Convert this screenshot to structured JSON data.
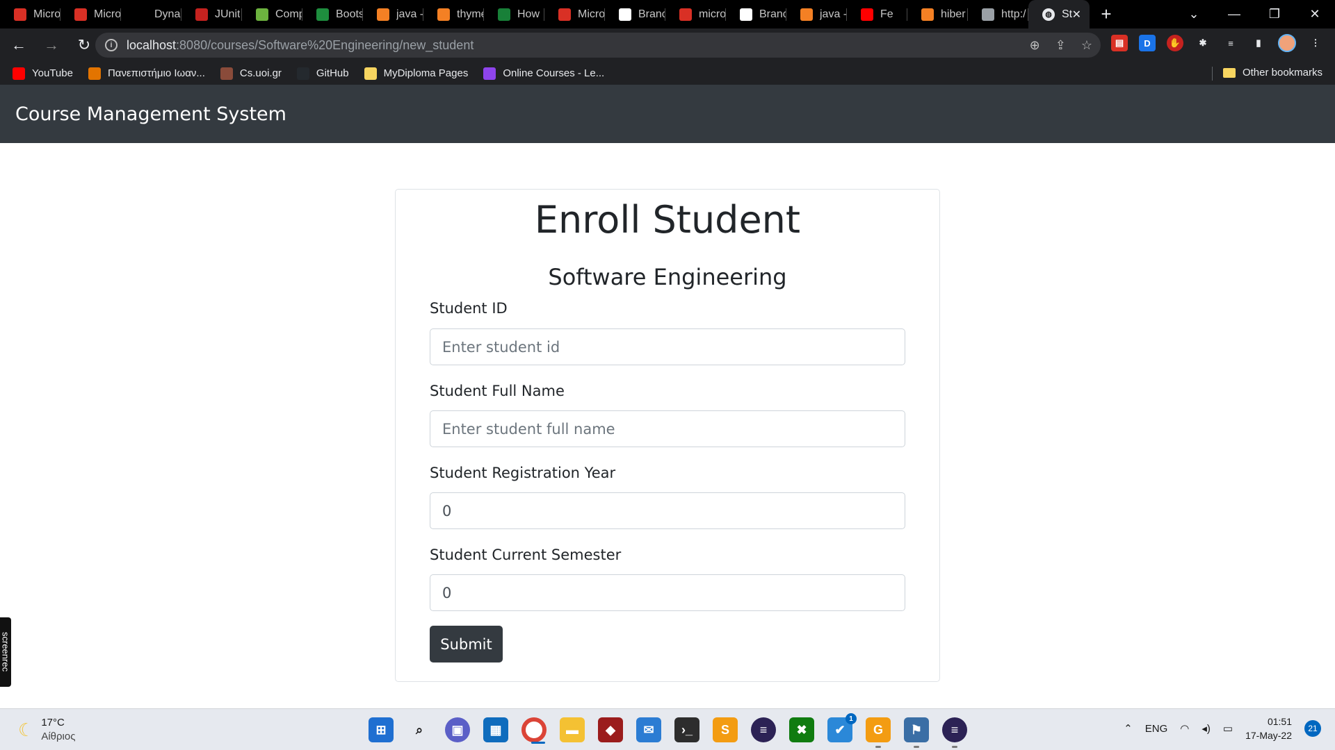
{
  "browser": {
    "tabs": [
      {
        "title": "Micro",
        "icon": "pdf-icon",
        "color": "#d93025"
      },
      {
        "title": "Micro",
        "icon": "pdf-icon",
        "color": "#d93025"
      },
      {
        "title": "Dynam",
        "icon": "pb-icon",
        "color": "#000000"
      },
      {
        "title": "JUnit",
        "icon": "junit-icon",
        "color": "#c5221f"
      },
      {
        "title": "Comp",
        "icon": "leaf-icon",
        "color": "#6db33f"
      },
      {
        "title": "Boots",
        "icon": "w-icon",
        "color": "#1e8e3e"
      },
      {
        "title": "java -",
        "icon": "stackoverflow-icon",
        "color": "#f48024"
      },
      {
        "title": "thyme",
        "icon": "stackoverflow-icon",
        "color": "#f48024"
      },
      {
        "title": "How",
        "icon": "ti-icon",
        "color": "#188038"
      },
      {
        "title": "Micro",
        "icon": "pdf-icon",
        "color": "#d93025"
      },
      {
        "title": "Branc",
        "icon": "wikipedia-icon",
        "color": "#ffffff"
      },
      {
        "title": "micro",
        "icon": "pdf-icon",
        "color": "#d93025"
      },
      {
        "title": "Branc",
        "icon": "wikipedia-icon",
        "color": "#ffffff"
      },
      {
        "title": "java -",
        "icon": "stackoverflow-icon",
        "color": "#f48024"
      },
      {
        "title": "Fe",
        "icon": "youtube-icon",
        "color": "#ff0000"
      },
      {
        "title": "hiber",
        "icon": "stackoverflow-icon",
        "color": "#f48024"
      },
      {
        "title": "http:/",
        "icon": "page-icon",
        "color": "#9aa0a6"
      }
    ],
    "active_tab": {
      "title": "St",
      "close": "✕"
    },
    "url_host": "localhost",
    "url_path": ":8080/courses/Software%20Engineering/new_student",
    "bookmarks": [
      {
        "label": "YouTube",
        "color": "#ff0000"
      },
      {
        "label": "Πανεπιστήμιο Ιωαν...",
        "color": "#e37400"
      },
      {
        "label": "Cs.uoi.gr",
        "color": "#8a4b3a"
      },
      {
        "label": "GitHub",
        "color": "#24292e"
      },
      {
        "label": "MyDiploma Pages",
        "color": "#f7d560"
      },
      {
        "label": "Online Courses - Le...",
        "color": "#8e44ec"
      }
    ],
    "other_bookmarks": "Other bookmarks"
  },
  "app": {
    "brand": "Course Management System"
  },
  "form": {
    "title": "Enroll Student",
    "course": "Software Engineering",
    "fields": [
      {
        "label": "Student ID",
        "placeholder": "Enter student id",
        "value": ""
      },
      {
        "label": "Student Full Name",
        "placeholder": "Enter student full name",
        "value": ""
      },
      {
        "label": "Student Registration Year",
        "placeholder": "",
        "value": "0"
      },
      {
        "label": "Student Current Semester",
        "placeholder": "",
        "value": "0"
      }
    ],
    "submit_label": "Submit"
  },
  "screenrec": "screenrec",
  "taskbar": {
    "temperature": "17°C",
    "weather": "Αίθριος",
    "language": "ENG",
    "time": "01:51",
    "date": "17-May-22",
    "notifications": "21",
    "badge": "1"
  }
}
